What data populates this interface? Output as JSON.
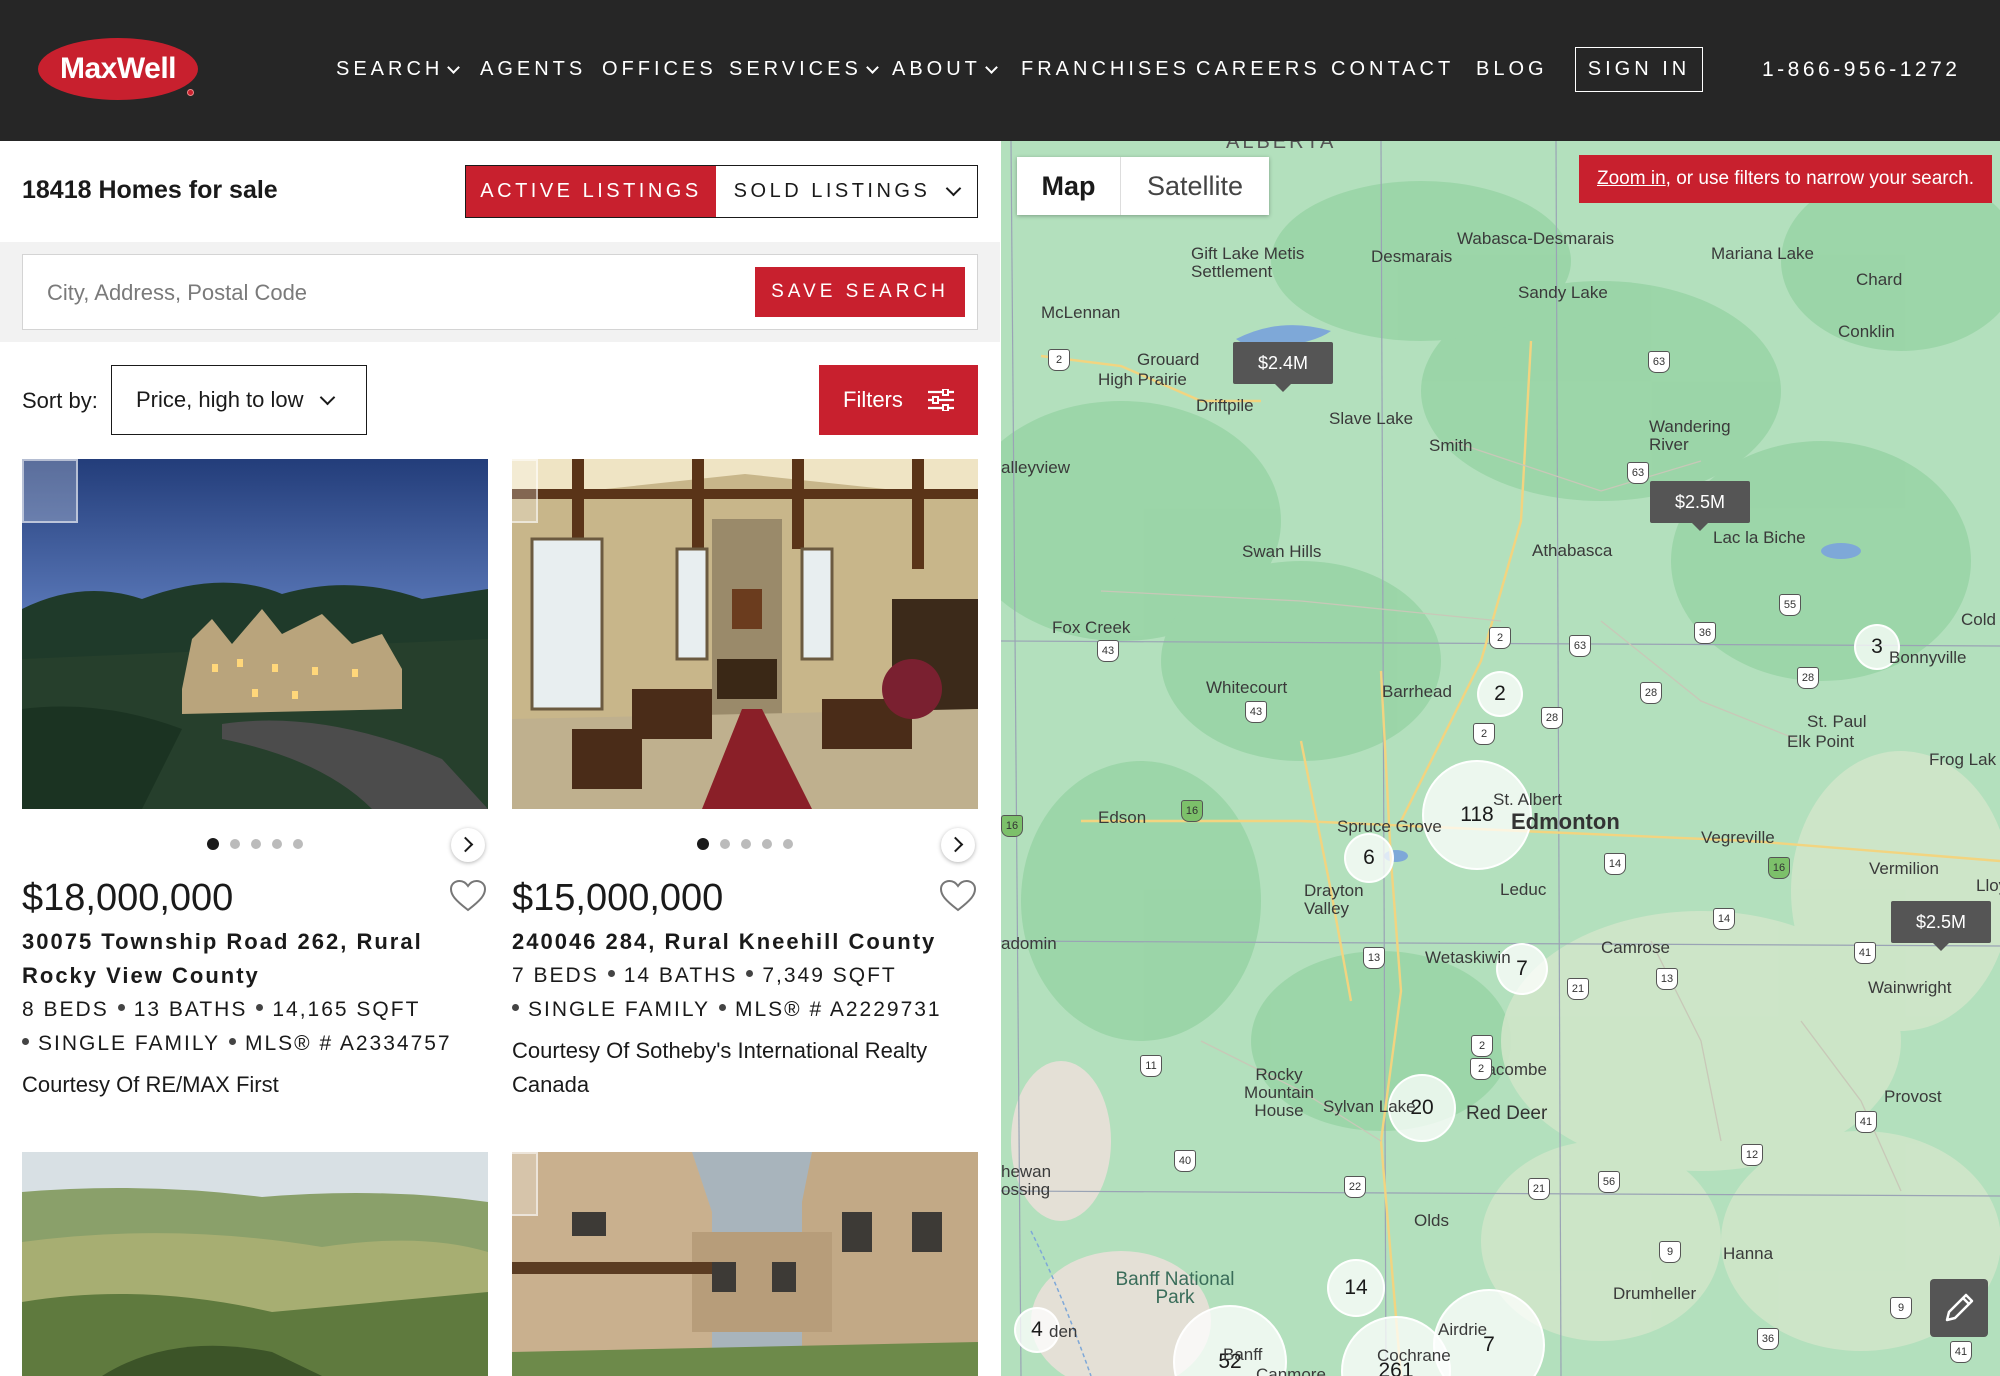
{
  "header": {
    "logo_text": "MaxWell",
    "nav": [
      {
        "label": "SEARCH",
        "dropdown": true
      },
      {
        "label": "AGENTS",
        "dropdown": false
      },
      {
        "label": "OFFICES",
        "dropdown": false
      },
      {
        "label": "SERVICES",
        "dropdown": true
      },
      {
        "label": "ABOUT",
        "dropdown": true
      },
      {
        "label": "FRANCHISES",
        "dropdown": false
      },
      {
        "label": "CAREERS",
        "dropdown": false
      },
      {
        "label": "CONTACT",
        "dropdown": false
      },
      {
        "label": "BLOG",
        "dropdown": false
      }
    ],
    "sign_in": "SIGN IN",
    "phone": "1-866-956-1272"
  },
  "listings_bar": {
    "count_text": "18418 Homes for sale",
    "active_label": "ACTIVE LISTINGS",
    "sold_label": "SOLD LISTINGS"
  },
  "search": {
    "placeholder": "City, Address, Postal Code",
    "value": "",
    "save_label": "SAVE SEARCH"
  },
  "sort": {
    "label": "Sort by:",
    "selected": "Price, high to low",
    "filters_label": "Filters"
  },
  "listings": [
    {
      "price": "$18,000,000",
      "address": "30075 Township Road 262, Rural Rocky View County",
      "specs_line1": [
        "8 BEDS",
        "13 BATHS",
        "14,165 SQFT"
      ],
      "specs_line2": [
        "SINGLE FAMILY",
        "MLS® # A2334757"
      ],
      "courtesy": "Courtesy Of RE/MAX First",
      "photo_count": 5,
      "active_photo": 1
    },
    {
      "price": "$15,000,000",
      "address": "240046 284, Rural Kneehill County",
      "specs_line1": [
        "7 BEDS",
        "14 BATHS",
        "7,349 SQFT"
      ],
      "specs_line2": [
        "SINGLE FAMILY",
        "MLS® # A2229731"
      ],
      "courtesy": "Courtesy Of Sotheby's International Realty Canada",
      "photo_count": 5,
      "active_photo": 1
    }
  ],
  "map": {
    "map_label": "Map",
    "satellite_label": "Satellite",
    "zoom_note_link": "Zoom in",
    "zoom_note_rest": ", or use filters to narrow your search.",
    "price_tags": [
      "$2.4M",
      "$2.5M",
      "$2.5M"
    ],
    "clusters": [
      "118",
      "2",
      "3",
      "6",
      "7",
      "20",
      "14",
      "4",
      "52",
      "261",
      "7"
    ],
    "places": [
      "ALBERTA",
      "Wabasca-Desmarais",
      "Desmarais",
      "Mariana Lake",
      "Gift Lake Metis Settlement",
      "Sandy Lake",
      "Chard",
      "McLennan",
      "Conklin",
      "Grouard",
      "High Prairie",
      "Driftpile",
      "Slave Lake",
      "Smith",
      "Wandering River",
      "alleyview",
      "Lac la Biche",
      "Swan Hills",
      "Athabasca",
      "Fox Creek",
      "Cold",
      "Bonnyville",
      "Whitecourt",
      "Barrhead",
      "St. Paul",
      "Elk Point",
      "Frog Lak",
      "Edson",
      "Spruce Grove",
      "St. Albert",
      "Edmonton",
      "Vegreville",
      "Vermilion",
      "Drayton Valley",
      "Leduc",
      "Lloy",
      "adomin",
      "Wetaskiwin",
      "Camrose",
      "Wainwright",
      "Lacombe",
      "Rocky Mountain House",
      "Sylvan Lake",
      "Red Deer",
      "Provost",
      "hewan ossing",
      "Olds",
      "Hanna",
      "Banff National Park",
      "Drumheller",
      "Airdrie",
      "Banff",
      "Canmore",
      "Cochrane",
      "den"
    ],
    "highways": [
      "2",
      "63",
      "63",
      "2",
      "43",
      "43",
      "2",
      "2",
      "28",
      "36",
      "55",
      "28",
      "63",
      "28",
      "16",
      "16",
      "16",
      "14",
      "14",
      "13",
      "21",
      "13",
      "41",
      "2",
      "11",
      "41",
      "40",
      "22",
      "21",
      "56",
      "12",
      "9",
      "9",
      "36",
      "41"
    ]
  },
  "colors": {
    "brand_red": "#c8202e",
    "header_bg": "#262626",
    "map_green": "#aadcb5"
  }
}
